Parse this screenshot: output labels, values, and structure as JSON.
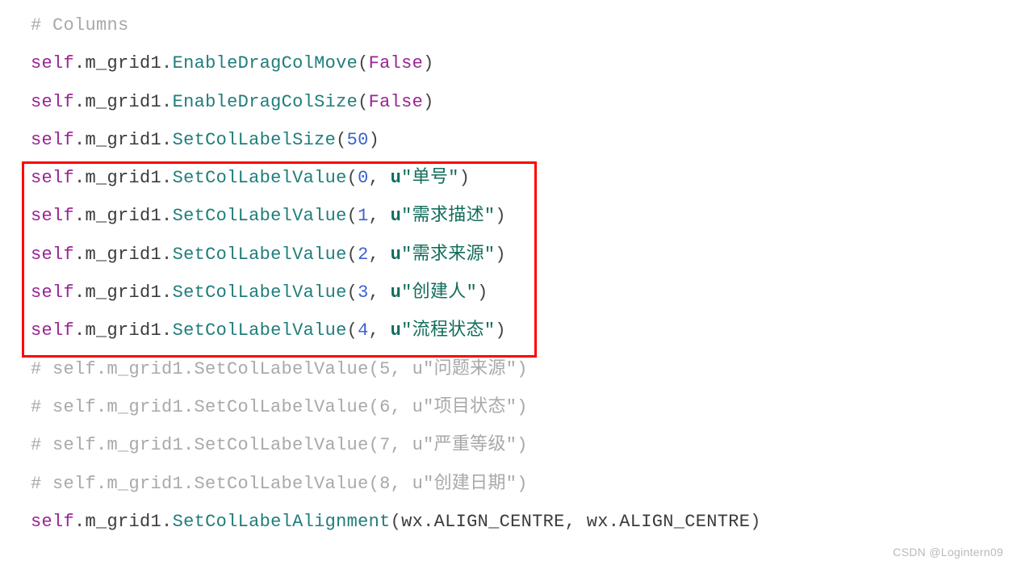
{
  "code_lines": [
    {
      "type": "comment",
      "text": "# Columns"
    },
    {
      "type": "call",
      "self": "self",
      "member": "m_grid1",
      "method": "EnableDragColMove",
      "arg_type": "bool",
      "arg": "False"
    },
    {
      "type": "call",
      "self": "self",
      "member": "m_grid1",
      "method": "EnableDragColSize",
      "arg_type": "bool",
      "arg": "False"
    },
    {
      "type": "call",
      "self": "self",
      "member": "m_grid1",
      "method": "SetColLabelSize",
      "arg_type": "num",
      "arg": "50"
    },
    {
      "type": "call_ustr",
      "self": "self",
      "member": "m_grid1",
      "method": "SetColLabelValue",
      "index": "0",
      "u": "u",
      "str": "\"单号\""
    },
    {
      "type": "call_ustr",
      "self": "self",
      "member": "m_grid1",
      "method": "SetColLabelValue",
      "index": "1",
      "u": "u",
      "str": "\"需求描述\""
    },
    {
      "type": "call_ustr",
      "self": "self",
      "member": "m_grid1",
      "method": "SetColLabelValue",
      "index": "2",
      "u": "u",
      "str": "\"需求来源\""
    },
    {
      "type": "call_ustr",
      "self": "self",
      "member": "m_grid1",
      "method": "SetColLabelValue",
      "index": "3",
      "u": "u",
      "str": "\"创建人\""
    },
    {
      "type": "call_ustr",
      "self": "self",
      "member": "m_grid1",
      "method": "SetColLabelValue",
      "index": "4",
      "u": "u",
      "str": "\"流程状态\""
    },
    {
      "type": "comment",
      "text": "# self.m_grid1.SetColLabelValue(5, u\"问题来源\")"
    },
    {
      "type": "comment",
      "text": "# self.m_grid1.SetColLabelValue(6, u\"项目状态\")"
    },
    {
      "type": "comment",
      "text": "# self.m_grid1.SetColLabelValue(7, u\"严重等级\")"
    },
    {
      "type": "comment",
      "text": "# self.m_grid1.SetColLabelValue(8, u\"创建日期\")"
    },
    {
      "type": "call_wx",
      "self": "self",
      "member": "m_grid1",
      "method": "SetColLabelAlignment",
      "wx1_mod": "wx",
      "wx1_attr": "ALIGN_CENTRE",
      "wx2_mod": "wx",
      "wx2_attr": "ALIGN_CENTRE"
    }
  ],
  "watermark": "CSDN @Logintern09"
}
